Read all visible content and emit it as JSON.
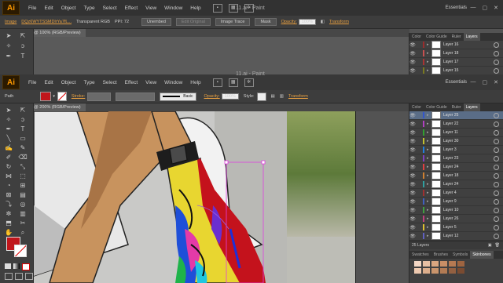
{
  "app": {
    "logo": "Ai",
    "menus": [
      "File",
      "Edit",
      "Object",
      "Type",
      "Select",
      "Effect",
      "View",
      "Window",
      "Help"
    ],
    "workspace": "Essentials",
    "search_icon": "search-icon"
  },
  "back_window": {
    "title": "11.ai - Paint",
    "control": {
      "label": "Image",
      "filename": "DQz6WYTSSMDlrYa7fL...",
      "mode": "Transparent RGB",
      "ppi": "PPI: 72",
      "embed": "Unembed",
      "edit_original": "Edit Original",
      "image_trace": "Image Trace",
      "mask": "Mask",
      "opacity_label": "Opacity:",
      "opacity": "100%",
      "transform": "Transform"
    },
    "doc_tab": "11.ai* @ 100% (RGB/Preview)",
    "panel_tabs": [
      "Color",
      "Color Guide",
      "Ruler",
      "Layers"
    ],
    "layers": [
      {
        "name": "Layer 16",
        "color": "#9b2c2c"
      },
      {
        "name": "Layer 18",
        "color": "#c85050"
      },
      {
        "name": "Layer 17",
        "color": "#aa3333"
      },
      {
        "name": "Layer 15",
        "color": "#7a7a20"
      }
    ]
  },
  "front_window": {
    "title": "11.ai - Paint",
    "control": {
      "label": "Path",
      "stroke_label": "Stroke:",
      "brush": "Basic",
      "opacity_label": "Opacity:",
      "opacity": "100%",
      "style_label": "Style:",
      "transform": "Transform"
    },
    "doc_tab": "11.ai* @ 200% (RGB/Preview)",
    "panel_tabs": [
      "Color",
      "Color Guide",
      "Ruler",
      "Layers"
    ],
    "layers": [
      {
        "name": "Layer 25",
        "color": "#3355cc",
        "selected": true
      },
      {
        "name": "Layer 22",
        "color": "#b040c0"
      },
      {
        "name": "Layer 11",
        "color": "#30a030"
      },
      {
        "name": "Layer 30",
        "color": "#c0c030"
      },
      {
        "name": "Layer 3",
        "color": "#2080e0"
      },
      {
        "name": "Layer 23",
        "color": "#8040c0"
      },
      {
        "name": "Layer 24",
        "color": "#e04040"
      },
      {
        "name": "Layer 18",
        "color": "#d08030"
      },
      {
        "name": "Layer 24",
        "color": "#30a0a0"
      },
      {
        "name": "Layer 4",
        "color": "#a03030"
      },
      {
        "name": "Layer 9",
        "color": "#4060c0"
      },
      {
        "name": "Layer 10",
        "color": "#40a040"
      },
      {
        "name": "Layer 26",
        "color": "#c04080"
      },
      {
        "name": "Layer 5",
        "color": "#e0c030"
      },
      {
        "name": "Layer 12",
        "color": "#6060c0"
      }
    ],
    "layers_count": "25 Layers",
    "swatch_tabs": [
      "Swatches",
      "Brushes",
      "Symbols",
      "Skinbones"
    ]
  }
}
